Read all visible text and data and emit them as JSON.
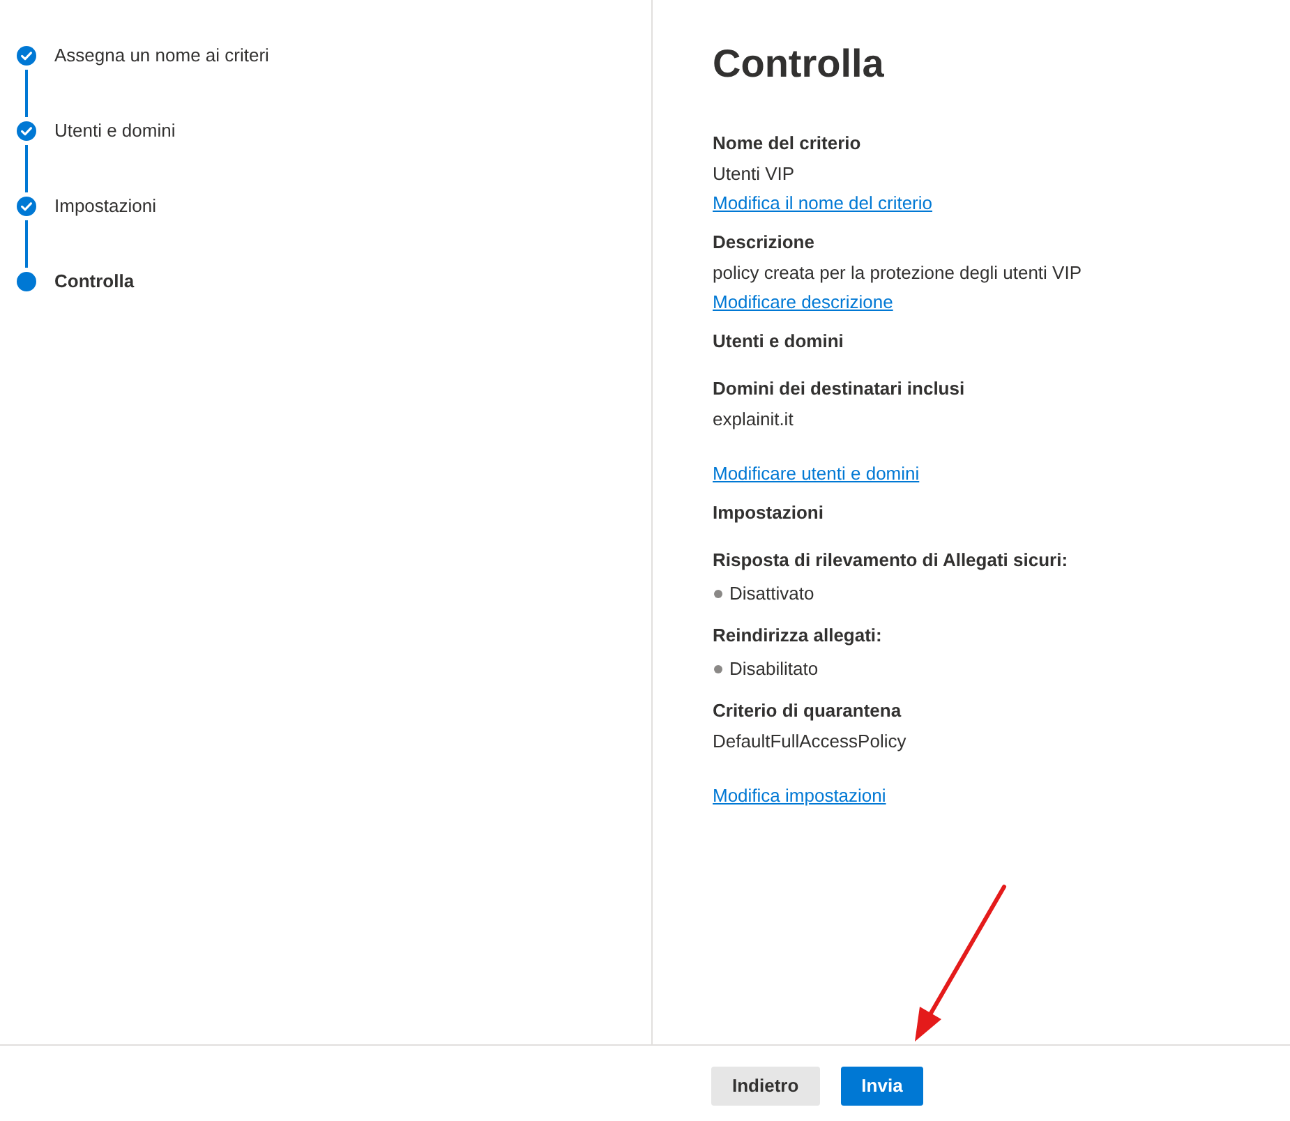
{
  "steps": [
    {
      "label": "Assegna un nome ai criteri",
      "completed": true,
      "selected": false
    },
    {
      "label": "Utenti e domini",
      "completed": true,
      "selected": false
    },
    {
      "label": "Impostazioni",
      "completed": true,
      "selected": false
    },
    {
      "label": "Controlla",
      "completed": false,
      "selected": true
    }
  ],
  "review": {
    "title": "Controlla",
    "sections": [
      {
        "kind": "simple",
        "title": "Nome del criterio",
        "value": "Utenti VIP",
        "link": "Modifica il nome del criterio"
      },
      {
        "kind": "simple",
        "title": "Descrizione",
        "value": "policy creata per la protezione degli utenti VIP",
        "link": "Modificare descrizione"
      },
      {
        "kind": "group",
        "title": "Utenti e domini",
        "fields": [
          {
            "kind": "plain",
            "label": "Domini dei destinatari inclusi",
            "value": "explainit.it"
          }
        ],
        "link": "Modificare utenti e domini"
      },
      {
        "kind": "group",
        "title": "Impostazioni",
        "fields": [
          {
            "kind": "bullet",
            "label": "Risposta di rilevamento di Allegati sicuri:",
            "value": "Disattivato"
          },
          {
            "kind": "bullet",
            "label": "Reindirizza allegati:",
            "value": "Disabilitato"
          },
          {
            "kind": "plain",
            "label": "Criterio di quarantena",
            "value": "DefaultFullAccessPolicy"
          }
        ],
        "link": "Modifica impostazioni"
      }
    ]
  },
  "buttons": [
    {
      "label": "Indietro",
      "primary": false
    },
    {
      "label": "Invia",
      "primary": true
    }
  ],
  "annotation": {
    "kind": "arrow"
  }
}
